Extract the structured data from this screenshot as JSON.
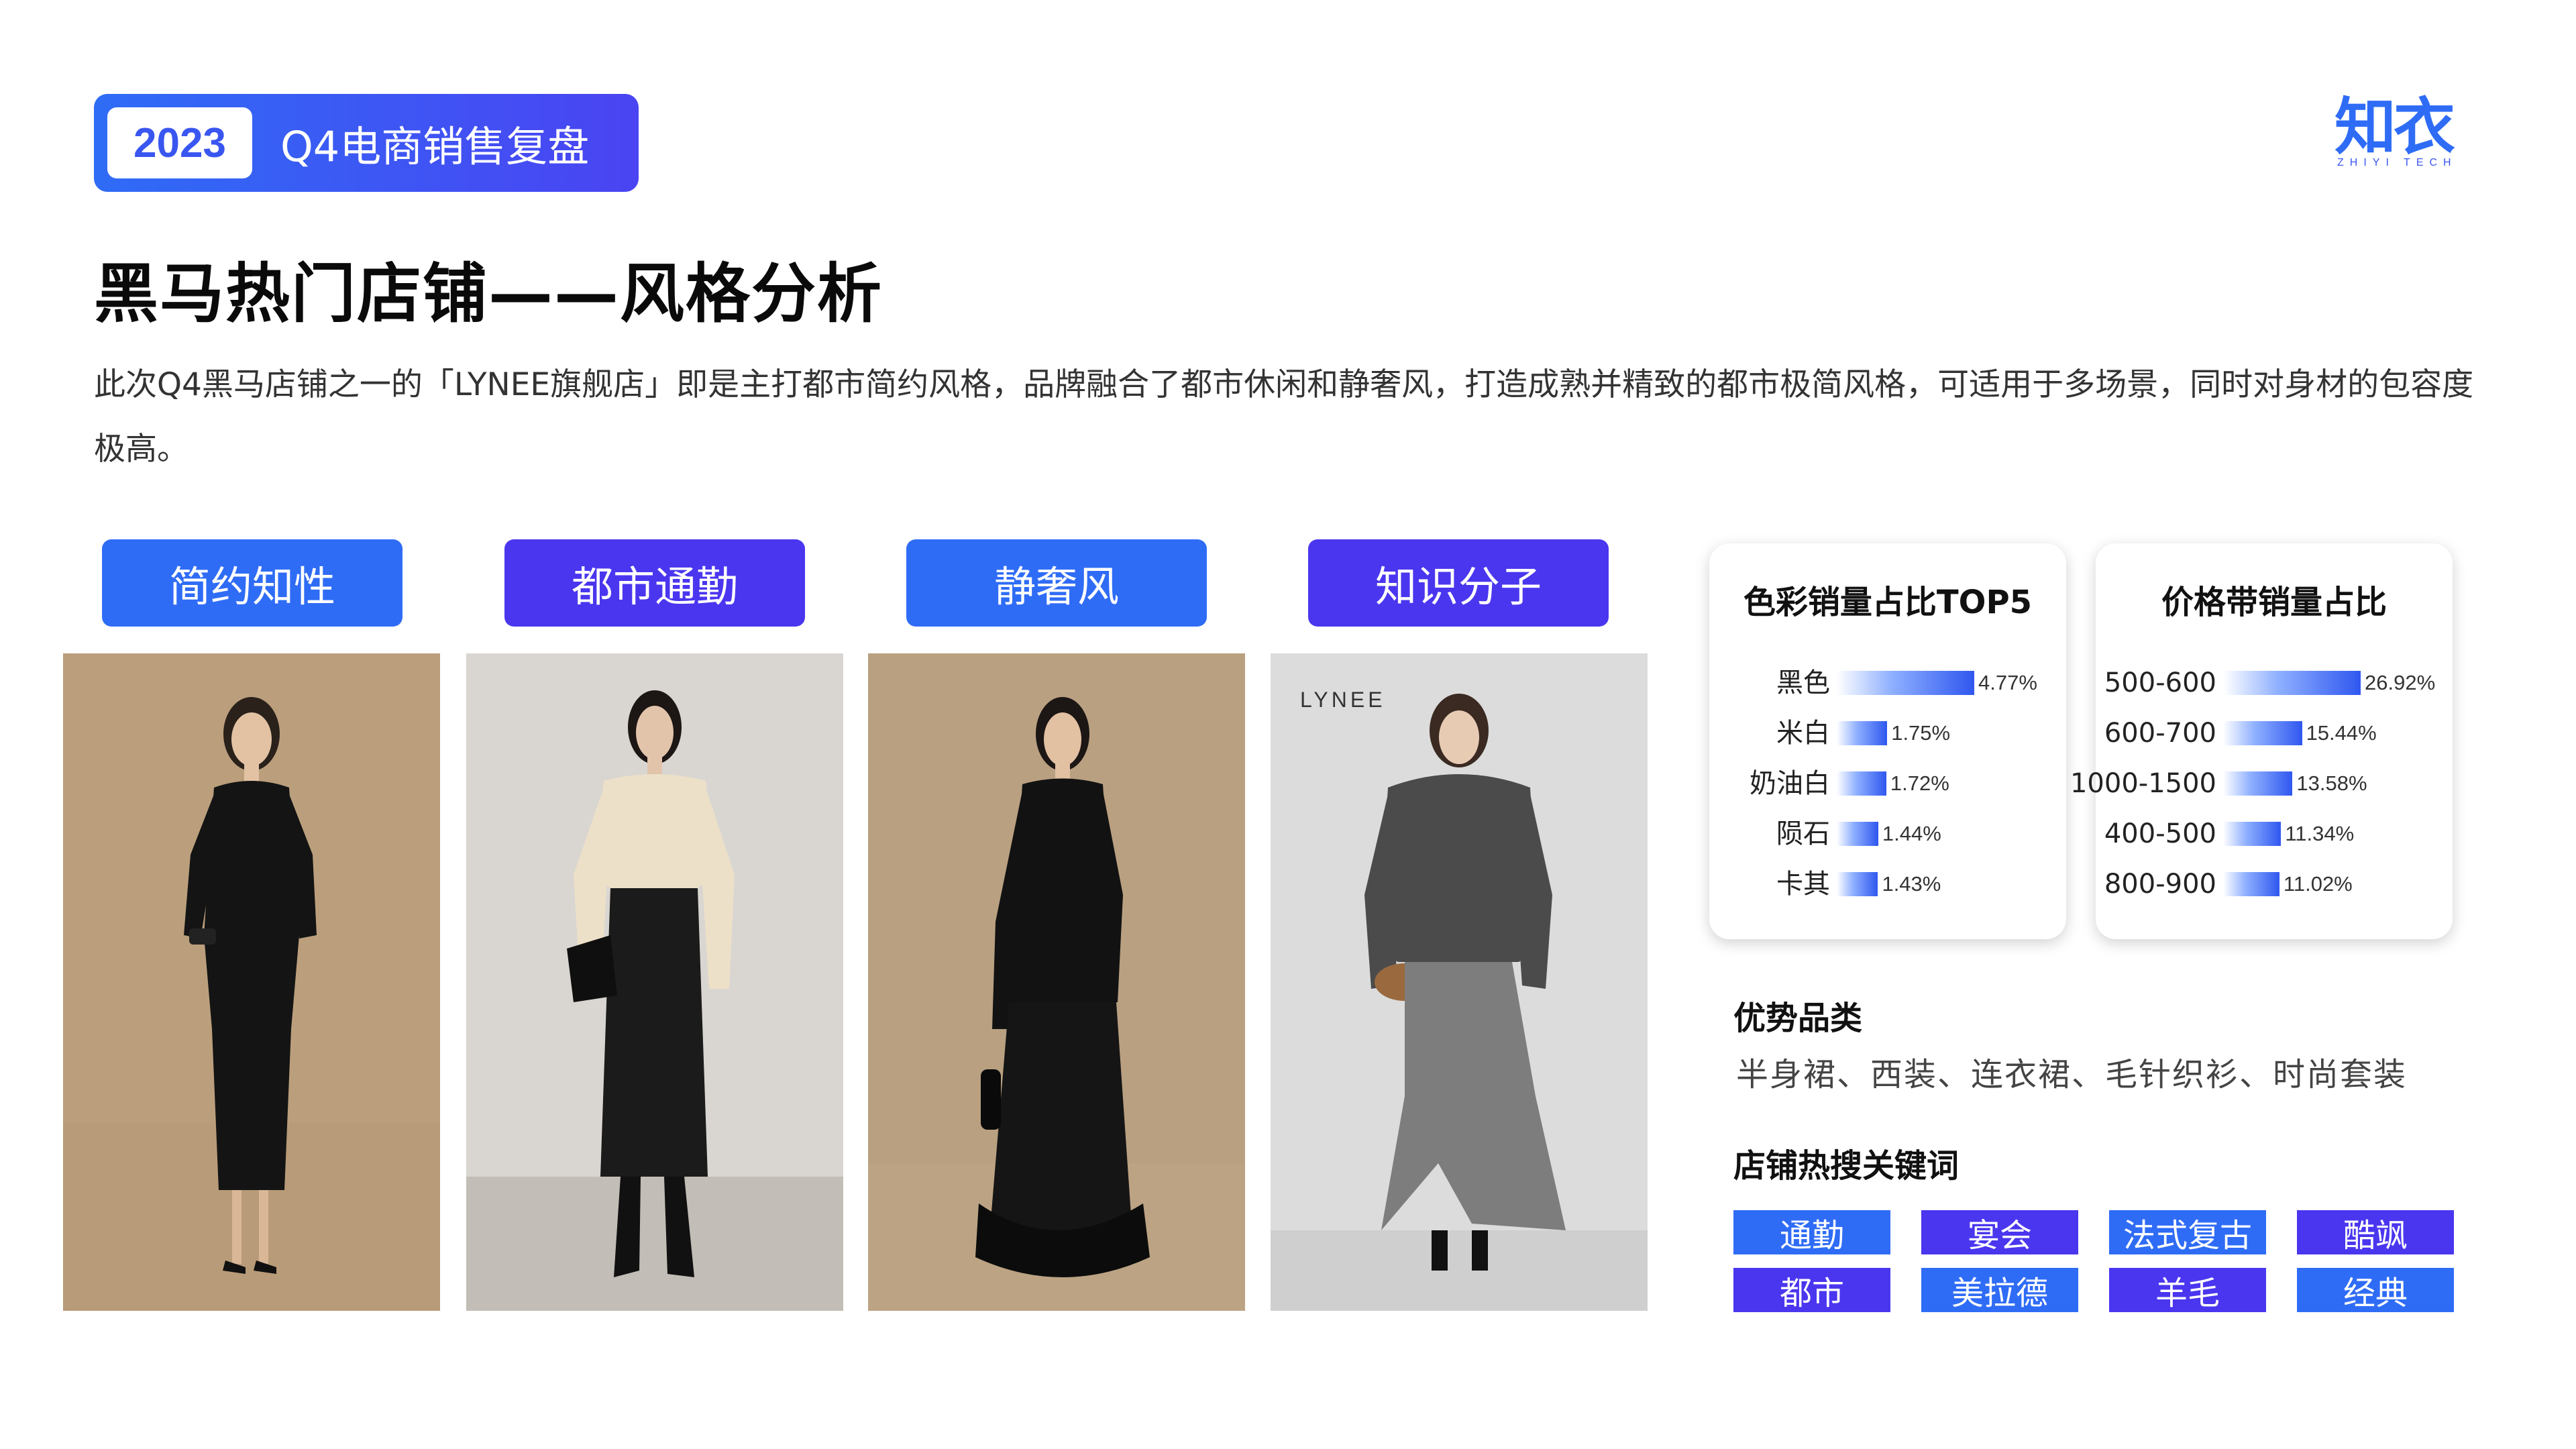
{
  "header": {
    "year": "2023",
    "subtitle": "Q4电商销售复盘"
  },
  "logo": {
    "mark": "知衣",
    "tagline": "ZHIYI TECH"
  },
  "title": "黑马热门店铺——风格分析",
  "description": "此次Q4黑马店铺之一的「LYNEE旗舰店」即是主打都市简约风格，品牌融合了都市休闲和静奢风，打造成熟并精致的都市极简风格，可适用于多场景，同时对身材的包容度极高。",
  "styles": [
    {
      "label": "简约知性",
      "color": "#2f6cf6"
    },
    {
      "label": "都市通勤",
      "color": "#4a36ef"
    },
    {
      "label": "静奢风",
      "color": "#2f6cf6"
    },
    {
      "label": "知识分子",
      "color": "#4a36ef"
    }
  ],
  "photo4_brand": "LYNEE",
  "color_card": {
    "title": "色彩销量占比TOP5",
    "rows": [
      {
        "label": "黑色",
        "value": "4.77%",
        "pct": 4.77
      },
      {
        "label": "米白",
        "value": "1.75%",
        "pct": 1.75
      },
      {
        "label": "奶油白",
        "value": "1.72%",
        "pct": 1.72
      },
      {
        "label": "陨石",
        "value": "1.44%",
        "pct": 1.44
      },
      {
        "label": "卡其",
        "value": "1.43%",
        "pct": 1.43
      }
    ]
  },
  "price_card": {
    "title": "价格带销量占比",
    "rows": [
      {
        "label": "500-600",
        "value": "26.92%",
        "pct": 26.92
      },
      {
        "label": "600-700",
        "value": "15.44%",
        "pct": 15.44
      },
      {
        "label": "1000-1500",
        "value": "13.58%",
        "pct": 13.58
      },
      {
        "label": "400-500",
        "value": "11.34%",
        "pct": 11.34
      },
      {
        "label": "800-900",
        "value": "11.02%",
        "pct": 11.02
      }
    ]
  },
  "advantage": {
    "heading": "优势品类",
    "text": "半身裙、西装、连衣裙、毛针织衫、时尚套装"
  },
  "keywords": {
    "heading": "店铺热搜关键词",
    "row1": [
      "通勤",
      "宴会",
      "法式复古",
      "酷飒"
    ],
    "row2": [
      "都市",
      "美拉德",
      "羊毛",
      "经典"
    ]
  }
}
